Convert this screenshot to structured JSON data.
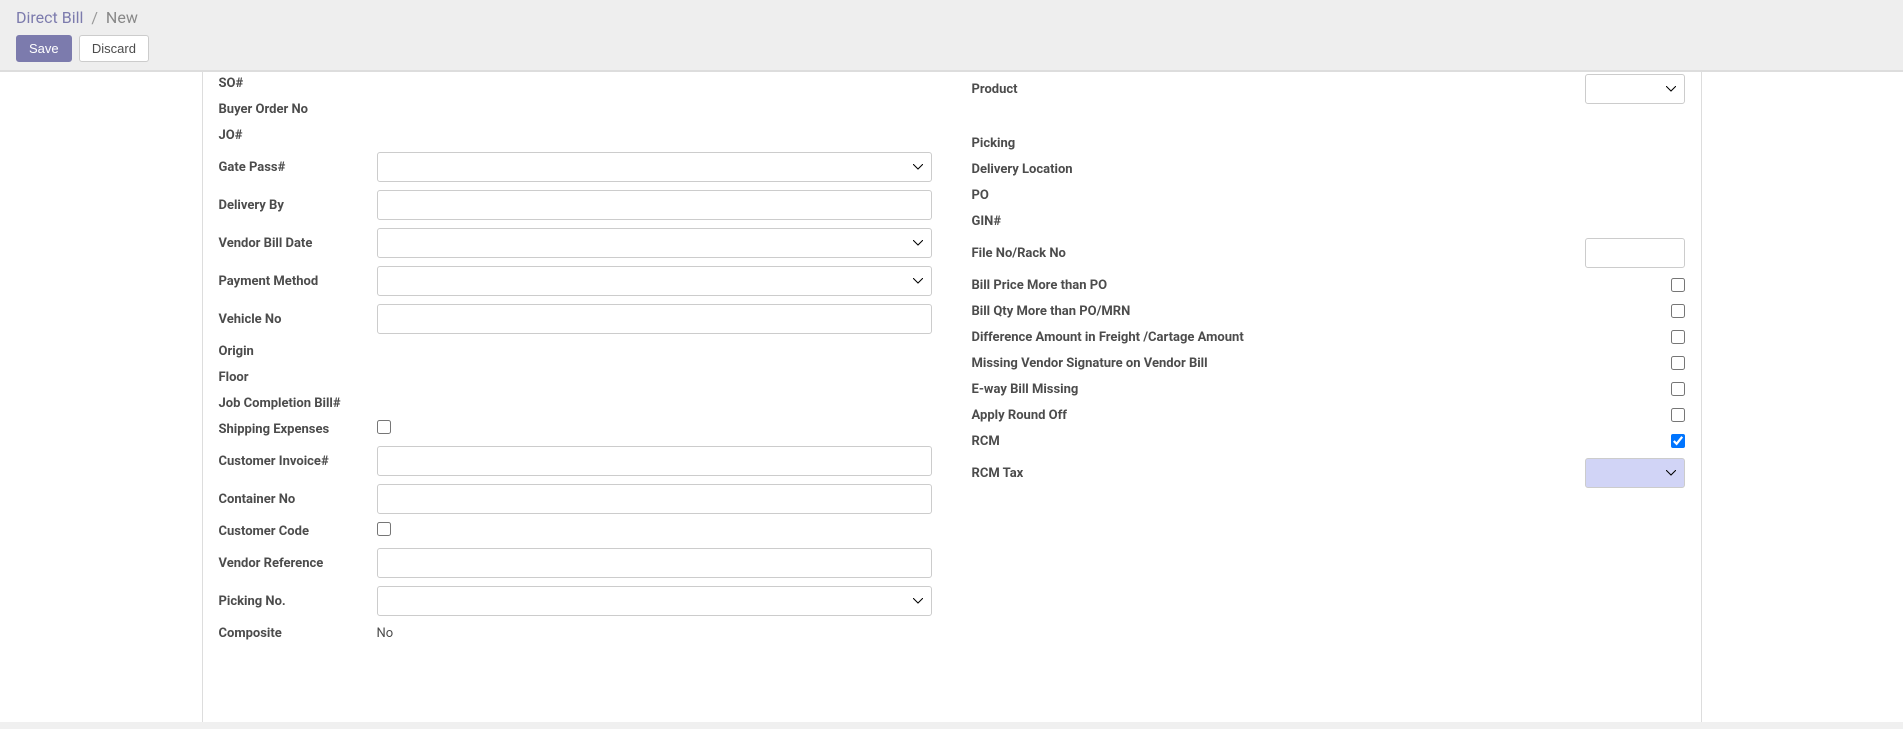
{
  "breadcrumb": {
    "root": "Direct Bill",
    "current": "New"
  },
  "actions": {
    "save": "Save",
    "discard": "Discard"
  },
  "left": {
    "so": "SO#",
    "buyer_order": "Buyer Order No",
    "jo": "JO#",
    "gate_pass": "Gate Pass#",
    "delivery_by": "Delivery By",
    "vendor_bill_date": "Vendor Bill Date",
    "payment_method": "Payment Method",
    "vehicle_no": "Vehicle No",
    "origin": "Origin",
    "floor": "Floor",
    "job_completion": "Job Completion Bill#",
    "shipping_exp": "Shipping Expenses",
    "customer_invoice": "Customer Invoice#",
    "container_no": "Container No",
    "customer_code": "Customer Code",
    "vendor_ref": "Vendor Reference",
    "picking_no": "Picking No.",
    "composite": "Composite",
    "composite_value": "No"
  },
  "right": {
    "product": "Product",
    "picking": "Picking",
    "delivery_location": "Delivery Location",
    "po": "PO",
    "gin": "GIN#",
    "file_rack": "File No/Rack No",
    "bill_price_more": "Bill Price More than PO",
    "bill_qty_more": "Bill Qty More than PO/MRN",
    "diff_amount": "Difference Amount in Freight /Cartage Amount",
    "missing_sig": "Missing Vendor Signature on Vendor Bill",
    "eway_missing": "E-way Bill Missing",
    "apply_round": "Apply Round Off",
    "rcm": "RCM",
    "rcm_tax": "RCM Tax"
  },
  "values": {
    "rcm_checked": true
  }
}
